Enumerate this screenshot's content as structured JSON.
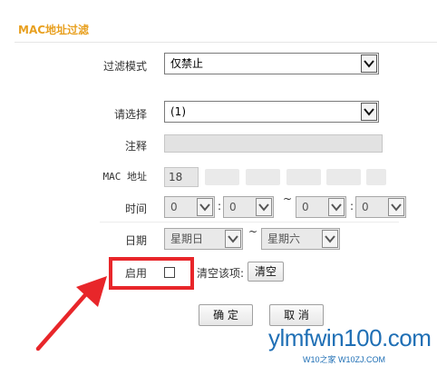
{
  "page": {
    "title": "MAC地址过滤"
  },
  "form": {
    "filter_mode": {
      "label": "过滤模式",
      "value": "仅禁止"
    },
    "select": {
      "label": "请选择",
      "value": "(1)"
    },
    "note": {
      "label": "注释",
      "value": ""
    },
    "mac": {
      "label": "MAC 地址",
      "first_octet": "18"
    },
    "time": {
      "label": "时间",
      "start_hour": "0",
      "start_min": "0",
      "end_hour": "0",
      "end_min": "0",
      "sep_colon": ":",
      "sep_tilde": "~"
    },
    "date": {
      "label": "日期",
      "start_day": "星期日",
      "end_day": "星期六",
      "sep_tilde": "~"
    },
    "enable": {
      "label": "启用",
      "checked": false
    },
    "clear": {
      "label": "清空该项:",
      "button": "清空"
    }
  },
  "actions": {
    "confirm": "确 定",
    "cancel": "取 消"
  },
  "watermark": {
    "line1": "ylmfwin100.com",
    "line2": "W10之家 W10ZJ.COM"
  },
  "colors": {
    "title": "#e8a020",
    "highlight": "#e8262a",
    "watermark": "#1f6fb5"
  }
}
